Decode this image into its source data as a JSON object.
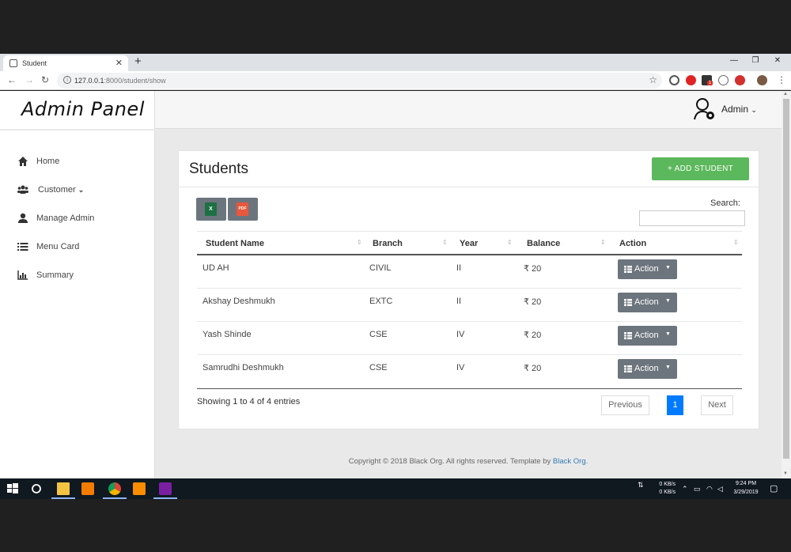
{
  "browser": {
    "tab_title": "Student",
    "tab_close": "✕",
    "new_tab": "+",
    "url_host": "127.0.0.1",
    "url_path": ":8000/student/show",
    "ext_badge": "1"
  },
  "brand": {
    "title": "Admin Panel"
  },
  "header": {
    "user_name": "Admin",
    "caret": "⌄"
  },
  "sidebar": {
    "items": [
      {
        "label": "Home",
        "icon": "home-icon"
      },
      {
        "label": "Customer",
        "icon": "users-icon",
        "caret": "⌄"
      },
      {
        "label": "Manage Admin",
        "icon": "user-icon"
      },
      {
        "label": "Menu Card",
        "icon": "list-icon"
      },
      {
        "label": "Summary",
        "icon": "bar-chart-icon"
      }
    ]
  },
  "card": {
    "title": "Students",
    "add_button": "+ ADD STUDENT",
    "export": {
      "excel": "X",
      "pdf": "PDF"
    },
    "search_label": "Search:",
    "search_value": ""
  },
  "table": {
    "headers": [
      "Student Name",
      "Branch",
      "Year",
      "Balance",
      "Action"
    ],
    "sort_glyph": "⇕",
    "rows": [
      {
        "name": "UD AH",
        "branch": "CIVIL",
        "year": "II",
        "balance": "₹ 20",
        "action": "Action"
      },
      {
        "name": "Akshay Deshmukh",
        "branch": "EXTC",
        "year": "II",
        "balance": "₹ 20",
        "action": "Action"
      },
      {
        "name": "Yash Shinde",
        "branch": "CSE",
        "year": "IV",
        "balance": "₹ 20",
        "action": "Action"
      },
      {
        "name": "Samrudhi Deshmukh",
        "branch": "CSE",
        "year": "IV",
        "balance": "₹ 20",
        "action": "Action"
      }
    ],
    "info": "Showing 1 to 4 of 4 entries",
    "pagination": {
      "previous": "Previous",
      "page": "1",
      "next": "Next"
    }
  },
  "footer": {
    "text": "Copyright © 2018 Black Org. All rights reserved. Template by ",
    "link": "Black Org",
    "end": "."
  },
  "taskbar": {
    "net_up": "0 KB/s",
    "net_down": "0 KB/s",
    "time": "9:24 PM",
    "date": "3/29/2019"
  },
  "colors": {
    "accent_green": "#5cb85c",
    "button_gray": "#6c757d",
    "page_active": "#007bff"
  }
}
